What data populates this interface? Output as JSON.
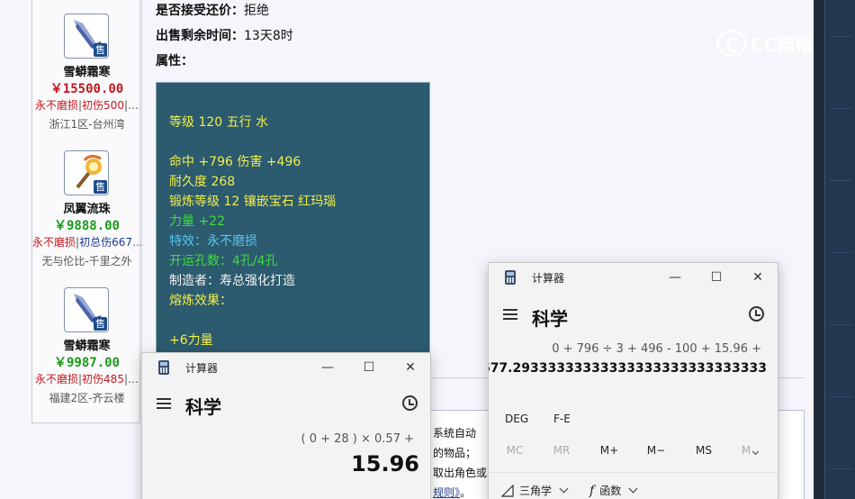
{
  "listing": {
    "accept_offer_label": "是否接受还价：",
    "accept_offer_value": "拒绝",
    "time_left_label": "出售剩余时间：",
    "time_left_value": "13天8时",
    "attributes_label": "属性："
  },
  "attributes": [
    {
      "text": "等级 120 五行 水",
      "color": "yellow"
    },
    {
      "text": "命中 +796 伤害 +496",
      "color": "yellow"
    },
    {
      "text": "耐久度 268",
      "color": "yellow"
    },
    {
      "text": "锻炼等级 12 镶嵌宝石 红玛瑙",
      "color": "yellow"
    },
    {
      "text": "力量 +22",
      "color": "green"
    },
    {
      "text": "特效：永不磨损",
      "color": "cyan"
    },
    {
      "text": "开运孔数：4孔/4孔",
      "color": "green"
    },
    {
      "text": "制造者：寿总强化打造",
      "color": "white"
    },
    {
      "text": "熔炼效果：",
      "color": "yellow"
    },
    {
      "text": "+6力量",
      "color": "yellow"
    }
  ],
  "sidebar_items": [
    {
      "name": "雪蟒霜寒",
      "price": "￥15500.00",
      "price_color": "#c3181e",
      "tag1": "永不磨损",
      "tag2": "初伤500",
      "tag2_color": "red",
      "more": "|…",
      "server": "浙江1区-台州湾",
      "sale_badge": "售",
      "icon": "frost-sword-icon"
    },
    {
      "name": "凤翼流珠",
      "price": "￥9888.00",
      "price_color": "#1a9a1a",
      "tag1": "永不磨损",
      "tag2": "初总伤667",
      "tag2_color": "blue",
      "more": "…",
      "server": "无与伦比-千里之外",
      "sale_badge": "售",
      "icon": "phoenix-orb-icon"
    },
    {
      "name": "雪蟒霜寒",
      "price": "￥9987.00",
      "price_color": "#1a9a1a",
      "tag1": "永不磨损",
      "tag2": "初伤485",
      "tag2_color": "red",
      "more": "|…",
      "server": "福建2区-齐云楼",
      "sale_badge": "售",
      "icon": "frost-sword-icon"
    }
  ],
  "rules_box": {
    "line1": "系统自动",
    "line2": "的物品；",
    "line3": "取出角色或",
    "link": "规则》",
    "link_suffix": "。"
  },
  "watermark": {
    "text": "CC商播"
  },
  "calc_left": {
    "title": "计算器",
    "mode": "科学",
    "expression": "( 0 + 28 ) × 0.57 +",
    "result": "15.96"
  },
  "calc_right": {
    "title": "计算器",
    "mode": "科学",
    "expression": "0 + 796 ÷ 3 + 496 - 100 + 15.96 +",
    "result": "677.29333333333333333333333333333",
    "angle_mode": "DEG",
    "fe_label": "F-E",
    "memory_buttons": [
      "MC",
      "MR",
      "M+",
      "M−",
      "MS",
      "M"
    ],
    "trig_label": "三角学",
    "func_label": "函数"
  },
  "window_controls": {
    "minimize": "—",
    "maximize": "☐",
    "close": "✕"
  }
}
